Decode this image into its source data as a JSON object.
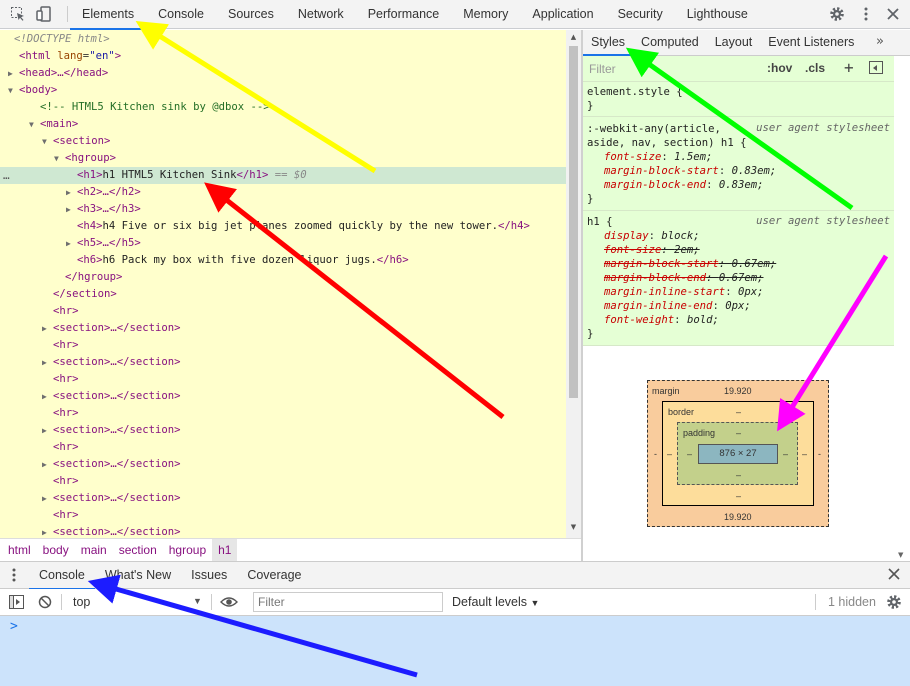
{
  "toolbar": {
    "inspect_icon": "inspect-element-icon",
    "device_icon": "device-toolbar-icon",
    "tabs": [
      {
        "label": "Elements",
        "active": true
      },
      {
        "label": "Console",
        "active": false
      },
      {
        "label": "Sources",
        "active": false
      },
      {
        "label": "Network",
        "active": false
      },
      {
        "label": "Performance",
        "active": false
      },
      {
        "label": "Memory",
        "active": false
      },
      {
        "label": "Application",
        "active": false
      },
      {
        "label": "Security",
        "active": false
      },
      {
        "label": "Lighthouse",
        "active": false
      }
    ],
    "settings_icon": "gear-icon",
    "more_icon": "kebab-menu-icon",
    "close_icon": "close-icon"
  },
  "dom": {
    "lines": [
      {
        "text": "<!DOCTYPE html>"
      },
      {
        "tag_open": "<html",
        "attr": "lang",
        "val": "\"en\"",
        "tag_close": ">"
      },
      {
        "text": "<head>…</head>"
      },
      {
        "text": "<body>"
      },
      {
        "comment": "<!-- HTML5 Kitchen sink by @dbox -->"
      },
      {
        "text": "<main>"
      },
      {
        "text": "<section>"
      },
      {
        "text": "<hgroup>"
      },
      {
        "tag_a": "<h1>",
        "content": "h1 HTML5 Kitchen Sink",
        "tag_b": "</h1>",
        "marker": " == $0"
      },
      {
        "text": "<h2>…</h2>"
      },
      {
        "text": "<h3>…</h3>"
      },
      {
        "tag_a": "<h4>",
        "content": "h4 Five or six big jet planes zoomed quickly by the new tower.",
        "tag_b": "</h4>"
      },
      {
        "text": "<h5>…</h5>"
      },
      {
        "tag_a": "<h6>",
        "content": "h6 Pack my box with five dozen liquor jugs.",
        "tag_b": "</h6>"
      },
      {
        "text": "</hgroup>"
      },
      {
        "text": "</section>"
      },
      {
        "text": "<hr>"
      },
      {
        "text": "<section>…</section>"
      },
      {
        "text": "<hr>"
      },
      {
        "text": "<section>…</section>"
      },
      {
        "text": "<hr>"
      },
      {
        "text": "<section>…</section>"
      },
      {
        "text": "<hr>"
      },
      {
        "text": "<section>…</section>"
      },
      {
        "text": "<hr>"
      },
      {
        "text": "<section>…</section>"
      },
      {
        "text": "<hr>"
      },
      {
        "text": "<section>…</section>"
      },
      {
        "text": "<hr>"
      },
      {
        "text": "<section>…</section>"
      }
    ],
    "dots": "…"
  },
  "breadcrumb": [
    "html",
    "body",
    "main",
    "section",
    "hgroup",
    "h1"
  ],
  "styles_tabs": [
    "Styles",
    "Computed",
    "Layout",
    "Event Listeners"
  ],
  "styles_more": "»",
  "filter": {
    "placeholder": "Filter",
    "hov": ":hov",
    "cls": ".cls",
    "plus": "+"
  },
  "rules": [
    {
      "lines": [
        "element.style {",
        "}"
      ]
    },
    {
      "selector": ":-webkit-any(article,",
      "selector2": "aside, nav, section) h1 {",
      "source": "user agent stylesheet",
      "props": [
        {
          "name": "font-size",
          "value": "1.5em;"
        },
        {
          "name": "margin-block-start",
          "value": "0.83em;"
        },
        {
          "name": "margin-block-end",
          "value": "0.83em;"
        }
      ]
    },
    {
      "selector": "h1 {",
      "source": "user agent stylesheet",
      "props": [
        {
          "name": "display",
          "value": "block;"
        },
        {
          "name": "font-size",
          "value": "2em;"
        },
        {
          "name": "margin-block-start",
          "value": "0.67em;"
        },
        {
          "name": "margin-block-end",
          "value": "0.67em;"
        },
        {
          "name": "margin-inline-start",
          "value": "0px;"
        },
        {
          "name": "margin-inline-end",
          "value": "0px;"
        },
        {
          "name": "font-weight",
          "value": "bold;"
        }
      ]
    }
  ],
  "boxmodel": {
    "margin_label": "margin",
    "margin_top": "19.920",
    "margin_bottom": "19.920",
    "margin_left": "-",
    "margin_right": "-",
    "border_label": "border",
    "border_top": "–",
    "border_bottom": "–",
    "border_left": "–",
    "border_right": "–",
    "padding_label": "padding",
    "padding_top": "–",
    "padding_bottom": "–",
    "padding_left": "–",
    "padding_right": "–",
    "content": "876 × 27"
  },
  "drawer": {
    "tabs": [
      {
        "label": "Console",
        "active": true
      },
      {
        "label": "What's New",
        "active": false
      },
      {
        "label": "Issues",
        "active": false
      },
      {
        "label": "Coverage",
        "active": false
      }
    ],
    "context": "top",
    "filter_placeholder": "Filter",
    "levels": "Default levels",
    "hidden": "1 hidden",
    "prompt": ">"
  },
  "annotations": {
    "colors": [
      "#ffff00",
      "#ff0000",
      "#00ff00",
      "#ff00ff",
      "#1c1cff"
    ]
  }
}
